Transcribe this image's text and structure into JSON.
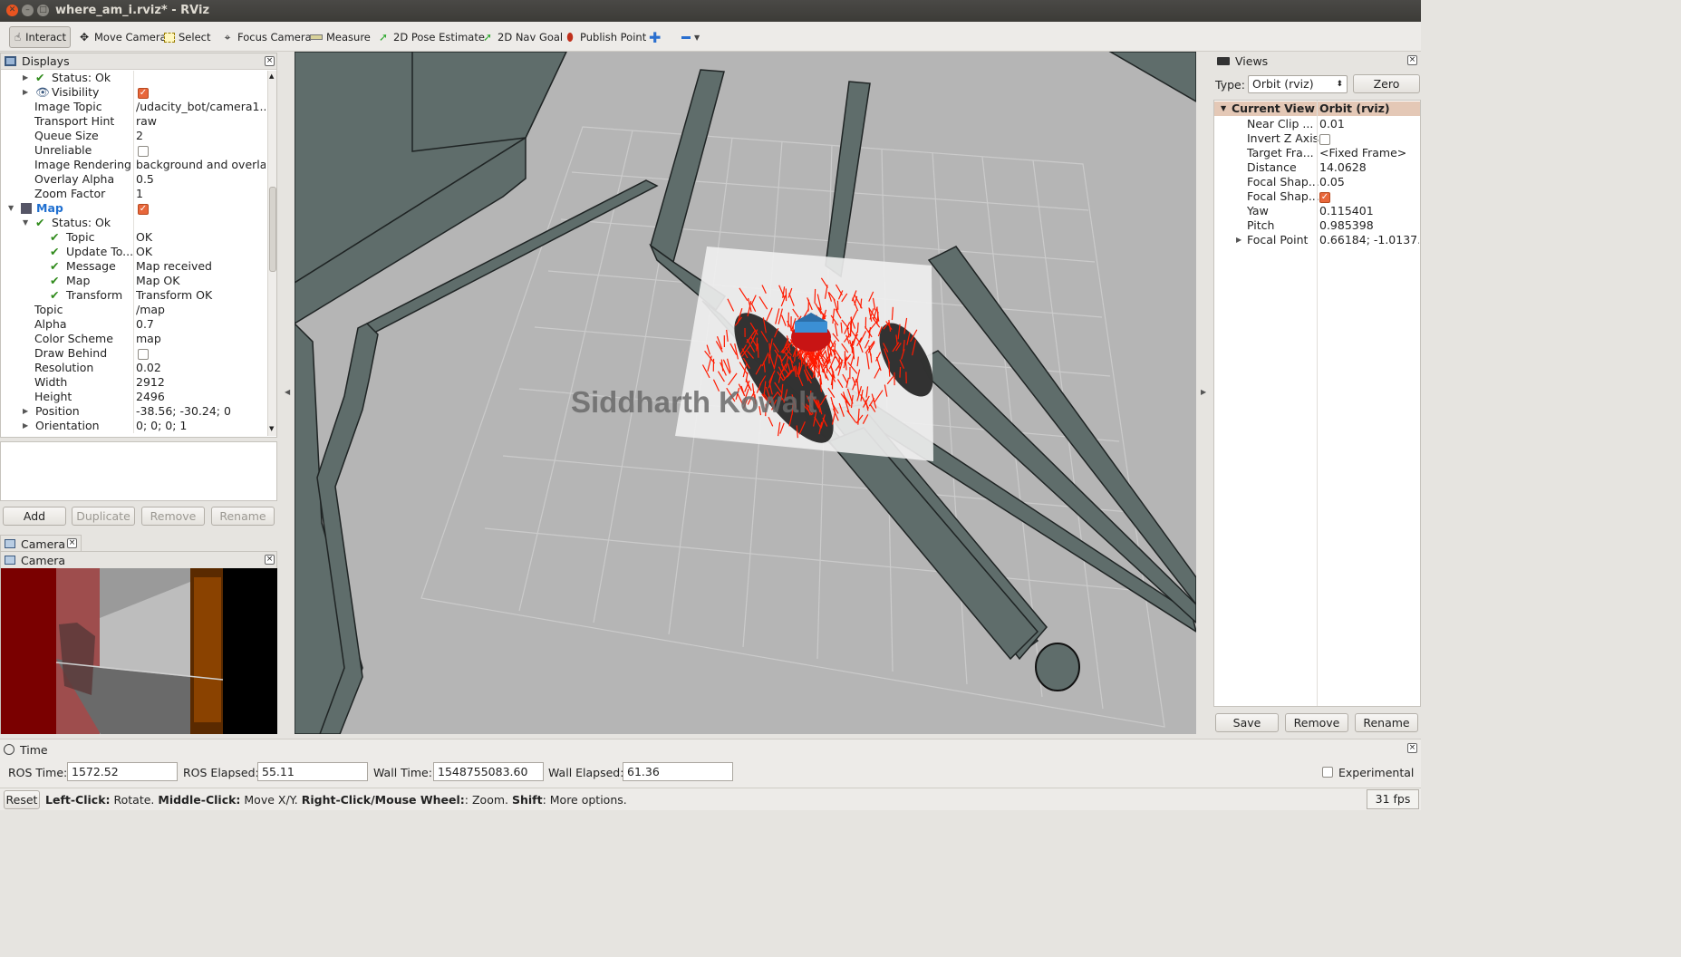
{
  "window": {
    "title": "where_am_i.rviz* - RViz"
  },
  "toolbar": {
    "tools": [
      {
        "label": "Interact",
        "icon": "hand-cursor-icon",
        "active": true
      },
      {
        "label": "Move Camera",
        "icon": "move-camera-icon"
      },
      {
        "label": "Select",
        "icon": "select-box-icon"
      },
      {
        "label": "Focus Camera",
        "icon": "focus-camera-icon"
      },
      {
        "label": "Measure",
        "icon": "ruler-icon"
      },
      {
        "label": "2D Pose Estimate",
        "icon": "green-arrow-icon"
      },
      {
        "label": "2D Nav Goal",
        "icon": "green-arrow-icon"
      },
      {
        "label": "Publish Point",
        "icon": "map-pin-icon"
      }
    ]
  },
  "displays": {
    "title": "Displays",
    "rows": [
      {
        "indent": 2,
        "expander": "right",
        "check": true,
        "key": "Status: Ok",
        "value": "",
        "vtype": "none"
      },
      {
        "indent": 2,
        "expander": "right",
        "eye": true,
        "key": "Visibility",
        "value": "",
        "vtype": "checkbox-on"
      },
      {
        "indent": 2,
        "key": "Image Topic",
        "value": "/udacity_bot/camera1...",
        "vtype": "text"
      },
      {
        "indent": 2,
        "key": "Transport Hint",
        "value": "raw",
        "vtype": "text"
      },
      {
        "indent": 2,
        "key": "Queue Size",
        "value": "2",
        "vtype": "text"
      },
      {
        "indent": 2,
        "key": "Unreliable",
        "value": "",
        "vtype": "checkbox-off"
      },
      {
        "indent": 2,
        "key": "Image Rendering",
        "value": "background and overlay",
        "vtype": "text"
      },
      {
        "indent": 2,
        "key": "Overlay Alpha",
        "value": "0.5",
        "vtype": "text"
      },
      {
        "indent": 2,
        "key": "Zoom Factor",
        "value": "1",
        "vtype": "text"
      },
      {
        "indent": 1,
        "expander": "down",
        "mapicon": true,
        "key": "Map",
        "value": "",
        "vtype": "checkbox-on",
        "highlight": true
      },
      {
        "indent": 2,
        "expander": "down",
        "check": true,
        "key": "Status: Ok",
        "value": "",
        "vtype": "none"
      },
      {
        "indent": 3,
        "check": true,
        "key": "Topic",
        "value": "OK",
        "vtype": "text"
      },
      {
        "indent": 3,
        "check": true,
        "key": "Update To...",
        "value": "OK",
        "vtype": "text"
      },
      {
        "indent": 3,
        "check": true,
        "key": "Message",
        "value": "Map received",
        "vtype": "text"
      },
      {
        "indent": 3,
        "check": true,
        "key": "Map",
        "value": "Map OK",
        "vtype": "text"
      },
      {
        "indent": 3,
        "check": true,
        "key": "Transform",
        "value": "Transform OK",
        "vtype": "text"
      },
      {
        "indent": 2,
        "key": "Topic",
        "value": "/map",
        "vtype": "text"
      },
      {
        "indent": 2,
        "key": "Alpha",
        "value": "0.7",
        "vtype": "text"
      },
      {
        "indent": 2,
        "key": "Color Scheme",
        "value": "map",
        "vtype": "text"
      },
      {
        "indent": 2,
        "key": "Draw Behind",
        "value": "",
        "vtype": "checkbox-off"
      },
      {
        "indent": 2,
        "key": "Resolution",
        "value": "0.02",
        "vtype": "text"
      },
      {
        "indent": 2,
        "key": "Width",
        "value": "2912",
        "vtype": "text"
      },
      {
        "indent": 2,
        "key": "Height",
        "value": "2496",
        "vtype": "text"
      },
      {
        "indent": 2,
        "expander": "right",
        "key": "Position",
        "value": "-38.56; -30.24; 0",
        "vtype": "text"
      },
      {
        "indent": 2,
        "expander": "right",
        "key": "Orientation",
        "value": "0; 0; 0; 1",
        "vtype": "text"
      }
    ],
    "buttons": {
      "add": "Add",
      "duplicate": "Duplicate",
      "remove": "Remove",
      "rename": "Rename"
    }
  },
  "camera": {
    "tab_label": "Camera",
    "panel_title": "Camera"
  },
  "viewport": {
    "watermark": "Siddharth Kowalt"
  },
  "views": {
    "title": "Views",
    "type_label": "Type:",
    "type_value": "Orbit (rviz)",
    "zero_button": "Zero",
    "header_key": "Current View",
    "header_value": "Orbit (rviz)",
    "rows": [
      {
        "key": "Near Clip ...",
        "value": "0.01",
        "vtype": "text"
      },
      {
        "key": "Invert Z Axis",
        "value": "",
        "vtype": "checkbox-off"
      },
      {
        "key": "Target Fra...",
        "value": "<Fixed Frame>",
        "vtype": "text"
      },
      {
        "key": "Distance",
        "value": "14.0628",
        "vtype": "text"
      },
      {
        "key": "Focal Shap...",
        "value": "0.05",
        "vtype": "text"
      },
      {
        "key": "Focal Shap...",
        "value": "",
        "vtype": "checkbox-on"
      },
      {
        "key": "Yaw",
        "value": "0.115401",
        "vtype": "text"
      },
      {
        "key": "Pitch",
        "value": "0.985398",
        "vtype": "text"
      },
      {
        "key": "Focal Point",
        "value": "0.66184; -1.0137...",
        "vtype": "text",
        "expander": true
      }
    ],
    "buttons": {
      "save": "Save",
      "remove": "Remove",
      "rename": "Rename"
    }
  },
  "time": {
    "title": "Time",
    "ros_time_label": "ROS Time:",
    "ros_time": "1572.52",
    "ros_elapsed_label": "ROS Elapsed:",
    "ros_elapsed": "55.11",
    "wall_time_label": "Wall Time:",
    "wall_time": "1548755083.60",
    "wall_elapsed_label": "Wall Elapsed:",
    "wall_elapsed": "61.36",
    "experimental_label": "Experimental"
  },
  "status": {
    "reset": "Reset",
    "hint_1_bold": "Left-Click:",
    "hint_1": " Rotate. ",
    "hint_2_bold": "Middle-Click:",
    "hint_2": " Move X/Y. ",
    "hint_3_bold": "Right-Click/Mouse Wheel:",
    "hint_3": ": Zoom. ",
    "hint_4_bold": "Shift",
    "hint_4": ": More options.",
    "fps": "31 fps"
  },
  "colors": {
    "accent_orange": "#e8673b",
    "particle_red": "#ff1a00",
    "map_wall": "#5f6d6b",
    "grid": "#cfcfcf"
  }
}
